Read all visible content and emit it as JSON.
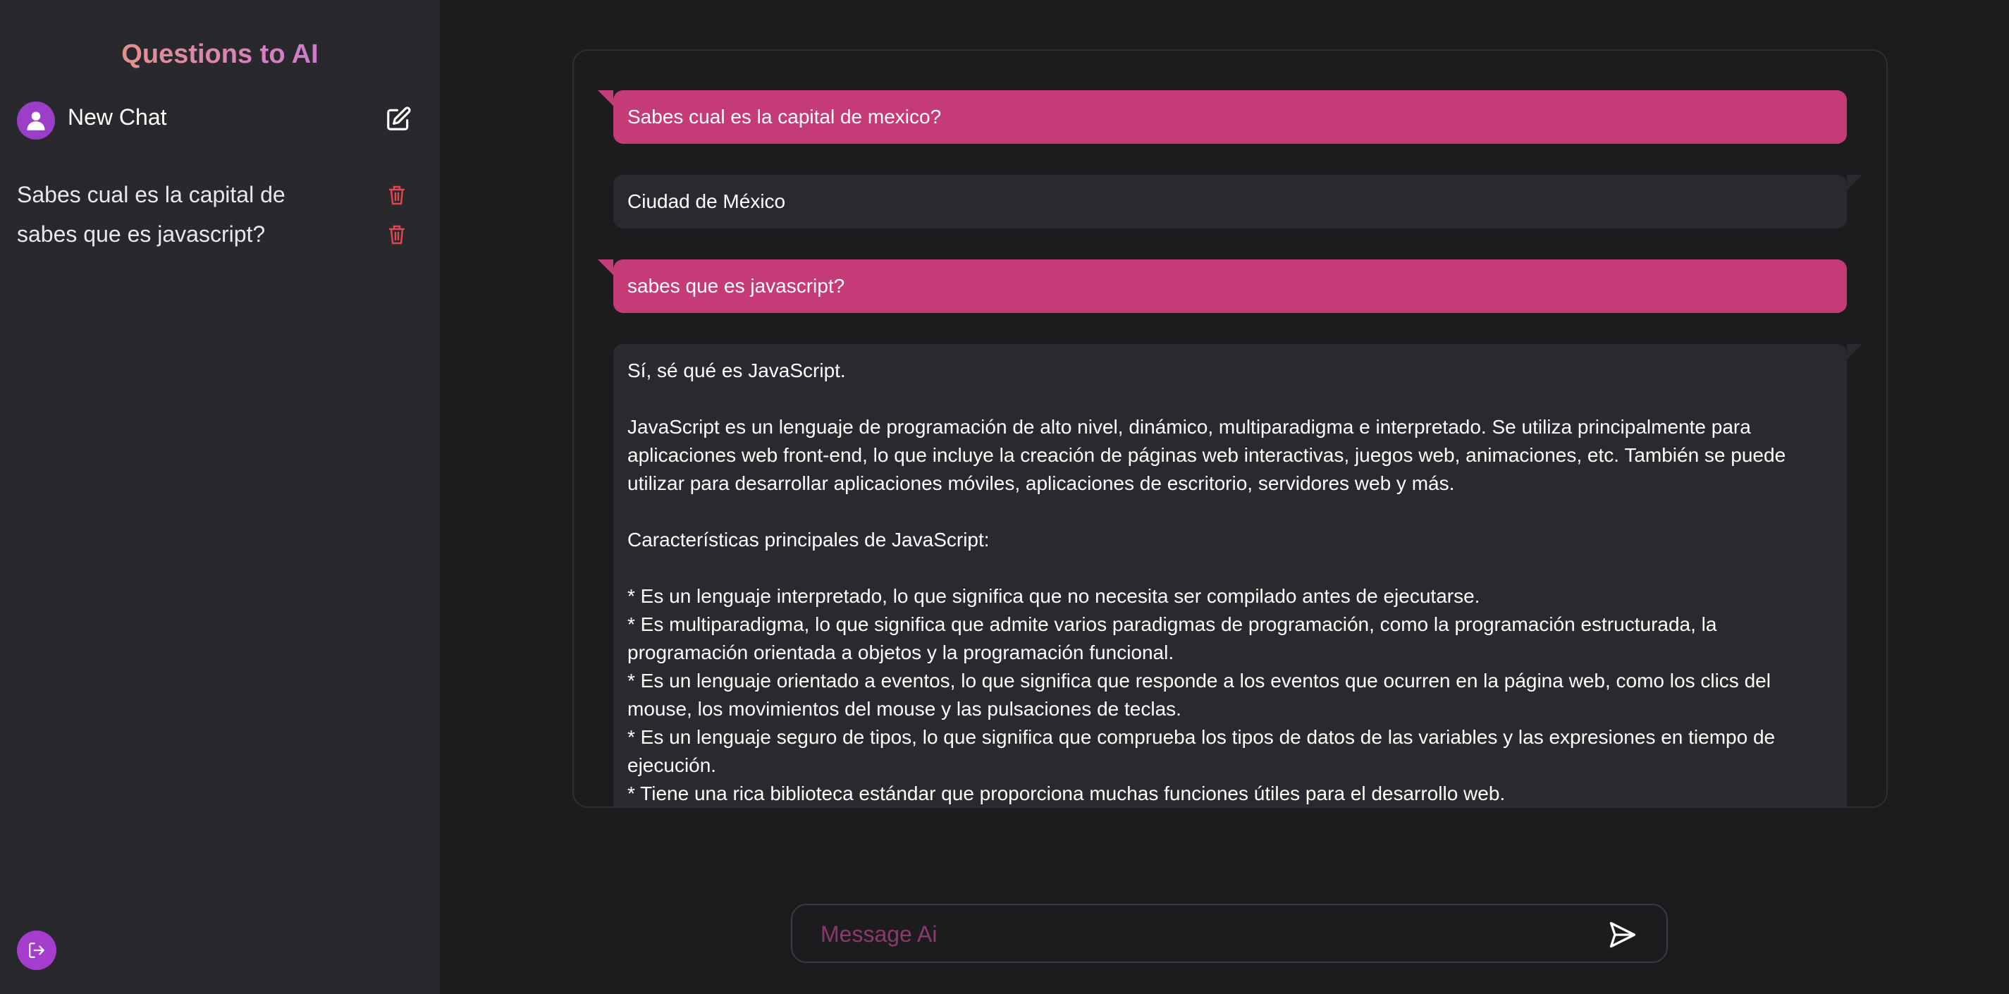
{
  "app": {
    "title": "Questions to AI"
  },
  "sidebar": {
    "new_chat_label": "New Chat",
    "history": [
      {
        "label": "Sabes cual es la capital de"
      },
      {
        "label": "sabes que es javascript?"
      }
    ]
  },
  "messages": [
    {
      "role": "user",
      "text": "Sabes cual es la capital de mexico?"
    },
    {
      "role": "ai",
      "text": "Ciudad de México"
    },
    {
      "role": "user",
      "text": "sabes que es javascript?"
    },
    {
      "role": "ai",
      "text": "Sí, sé qué es JavaScript.\n\nJavaScript es un lenguaje de programación de alto nivel, dinámico, multiparadigma e interpretado. Se utiliza principalmente para aplicaciones web front-end, lo que incluye la creación de páginas web interactivas, juegos web, animaciones, etc. También se puede utilizar para desarrollar aplicaciones móviles, aplicaciones de escritorio, servidores web y más.\n\nCaracterísticas principales de JavaScript:\n\n* Es un lenguaje interpretado, lo que significa que no necesita ser compilado antes de ejecutarse.\n* Es multiparadigma, lo que significa que admite varios paradigmas de programación, como la programación estructurada, la programación orientada a objetos y la programación funcional.\n* Es un lenguaje orientado a eventos, lo que significa que responde a los eventos que ocurren en la página web, como los clics del mouse, los movimientos del mouse y las pulsaciones de teclas.\n* Es un lenguaje seguro de tipos, lo que significa que comprueba los tipos de datos de las variables y las expresiones en tiempo de ejecución.\n* Tiene una rica biblioteca estándar que proporciona muchas funciones útiles para el desarrollo web."
    }
  ],
  "composer": {
    "placeholder": "Message Ai"
  },
  "icons": {
    "avatar": "user-icon",
    "new_chat": "edit-icon",
    "delete": "trash-icon",
    "logout": "logout-icon",
    "send": "send-icon"
  },
  "colors": {
    "user_bubble": "#c53b78",
    "ai_bubble": "#2a2a2e",
    "accent": "#a53ecf",
    "delete": "#e0484f"
  }
}
